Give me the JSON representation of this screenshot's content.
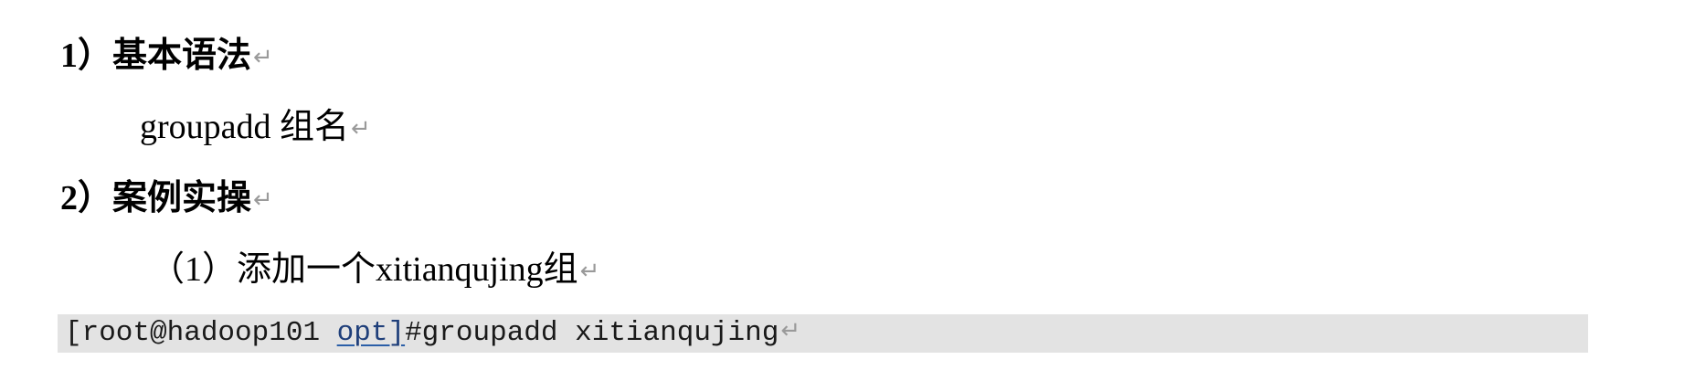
{
  "sections": [
    {
      "number": "1）",
      "title": "基本语法"
    },
    {
      "number": "2）",
      "title": "案例实操"
    }
  ],
  "syntax": {
    "command": "groupadd",
    "argument": "组名"
  },
  "case_step": {
    "number": "（1）",
    "text": "添加一个xitianqujing组"
  },
  "code": {
    "prefix": "[root@hadoop101 ",
    "underlined": "opt]",
    "suffix": "#groupadd xitianqujing"
  },
  "paragraph_mark": "↵"
}
